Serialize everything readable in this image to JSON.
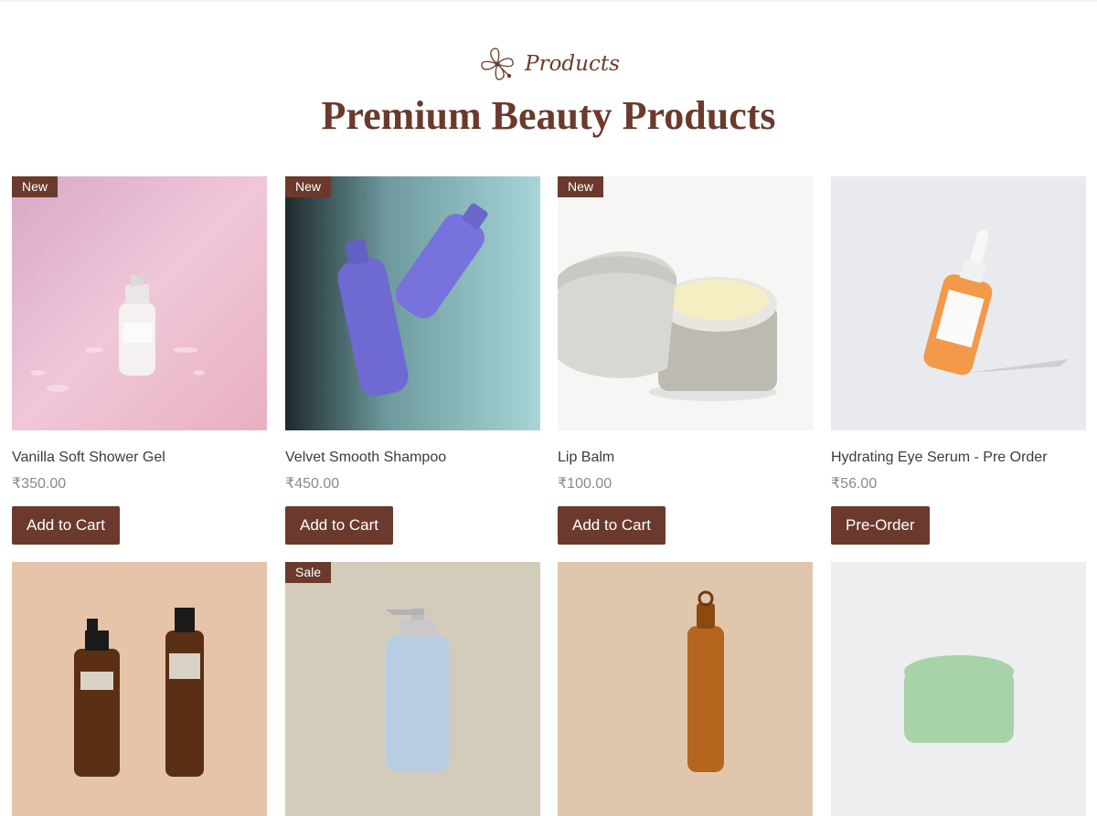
{
  "section": {
    "label": "Products",
    "title": "Premium Beauty Products"
  },
  "products": [
    {
      "name": "Vanilla Soft Shower Gel",
      "price": "₹350.00",
      "badge": "New",
      "cta": "Add to Cart"
    },
    {
      "name": "Velvet Smooth Shampoo",
      "price": "₹450.00",
      "badge": "New",
      "cta": "Add to Cart"
    },
    {
      "name": "Lip Balm",
      "price": "₹100.00",
      "badge": "New",
      "cta": "Add to Cart"
    },
    {
      "name": "Hydrating Eye Serum - Pre Order",
      "price": "₹56.00",
      "badge": "",
      "cta": "Pre-Order"
    }
  ],
  "products_row2": [
    {
      "badge": ""
    },
    {
      "badge": "Sale"
    },
    {
      "badge": ""
    },
    {
      "badge": ""
    }
  ],
  "colors": {
    "accent": "#6b3a2c",
    "text": "#3c3c3c",
    "price": "#8a8a8a"
  }
}
